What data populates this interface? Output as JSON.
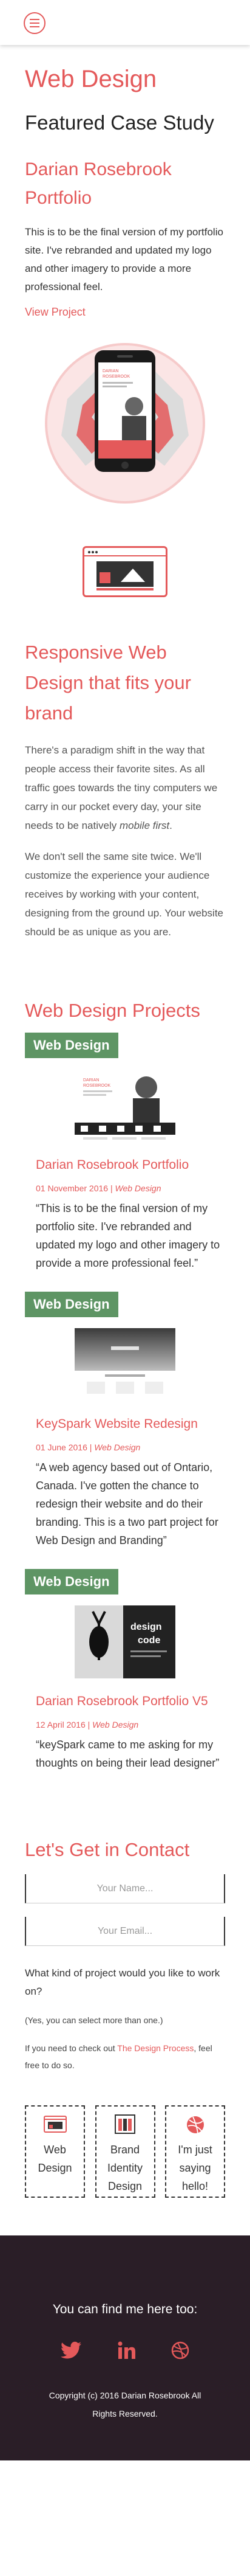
{
  "header": {
    "menu_icon": "hamburger-icon",
    "accent": "#e4595a"
  },
  "hero": {
    "title": "Web Design",
    "featured": "Featured Case Study",
    "case_title": "Darian Rosebrook Portfolio",
    "description": "This is to be the final version of my portfolio site. I've rebranded and updated my logo and other imagery to provide a more professional feel.",
    "view_link": "View Project",
    "phone_header_name_line1": "DARIAN",
    "phone_header_name_line2": "ROSEBROOK"
  },
  "responsive": {
    "heading": "Responsive Web Design that fits your brand",
    "p1_before": "There's a paradigm shift in the way that people access their favorite sites. As all traffic goes towards the tiny computers we carry in our pocket every day, your site needs to be natively ",
    "p1_em": "mobile first",
    "p1_after": ".",
    "p2": "We don't sell the same site twice. We'll customize the experience your audience receives by working with your content, designing from the ground up. Your website should be as unique as you are."
  },
  "projects": {
    "heading": "Web Design Projects",
    "items": [
      {
        "badge": "Web Design",
        "title": "Darian Rosebrook Portfolio",
        "date": "01 November 2016",
        "category": "Web Design",
        "quote": "“This is to be the final version of my portfolio site. I've rebranded and updated my logo and other imagery to provide a more professional feel.”",
        "thumb_line1": "DARIAN",
        "thumb_line2": "ROSEBROOK"
      },
      {
        "badge": "Web Design",
        "title": "KeySpark Website Redesign",
        "date": "01 June 2016",
        "category": "Web Design",
        "quote": "“A web agency based out of Ontario, Canada. I've gotten the chance to redesign their website and do their branding. This is a two part project for Web Design and Branding”",
        "thumb_line1": "",
        "thumb_line2": ""
      },
      {
        "badge": "Web Design",
        "title": "Darian Rosebrook Portfolio V5",
        "date": "12 April 2016",
        "category": "Web Design",
        "quote": "“keySpark came to me asking for my thoughts on being their lead designer”",
        "thumb_line1": "design",
        "thumb_line2": "code"
      }
    ],
    "date_separator": " | "
  },
  "contact": {
    "heading": "Let's Get in Contact",
    "name_placeholder": "Your Name...",
    "email_placeholder": "Your Email...",
    "question": "What kind of project would you like to work on?",
    "note": "(Yes, you can select more than one.)",
    "process_before": "If you need to check out ",
    "process_link": "The Design Process",
    "process_after": ", feel free to do so.",
    "choices": [
      {
        "label": "Web Design",
        "icon": "browser-icon"
      },
      {
        "label": "Brand Identity Design",
        "icon": "palette-icon"
      },
      {
        "label": "I'm just saying hello!",
        "icon": "dribbble-icon"
      }
    ]
  },
  "footer": {
    "find_text": "You can find me here too:",
    "socials": [
      "twitter-icon",
      "linkedin-icon",
      "dribbble-icon"
    ],
    "copyright": "Copyright (c) 2016 Darian Rosebrook All Rights Reserved.",
    "background": "#2a1e27"
  }
}
